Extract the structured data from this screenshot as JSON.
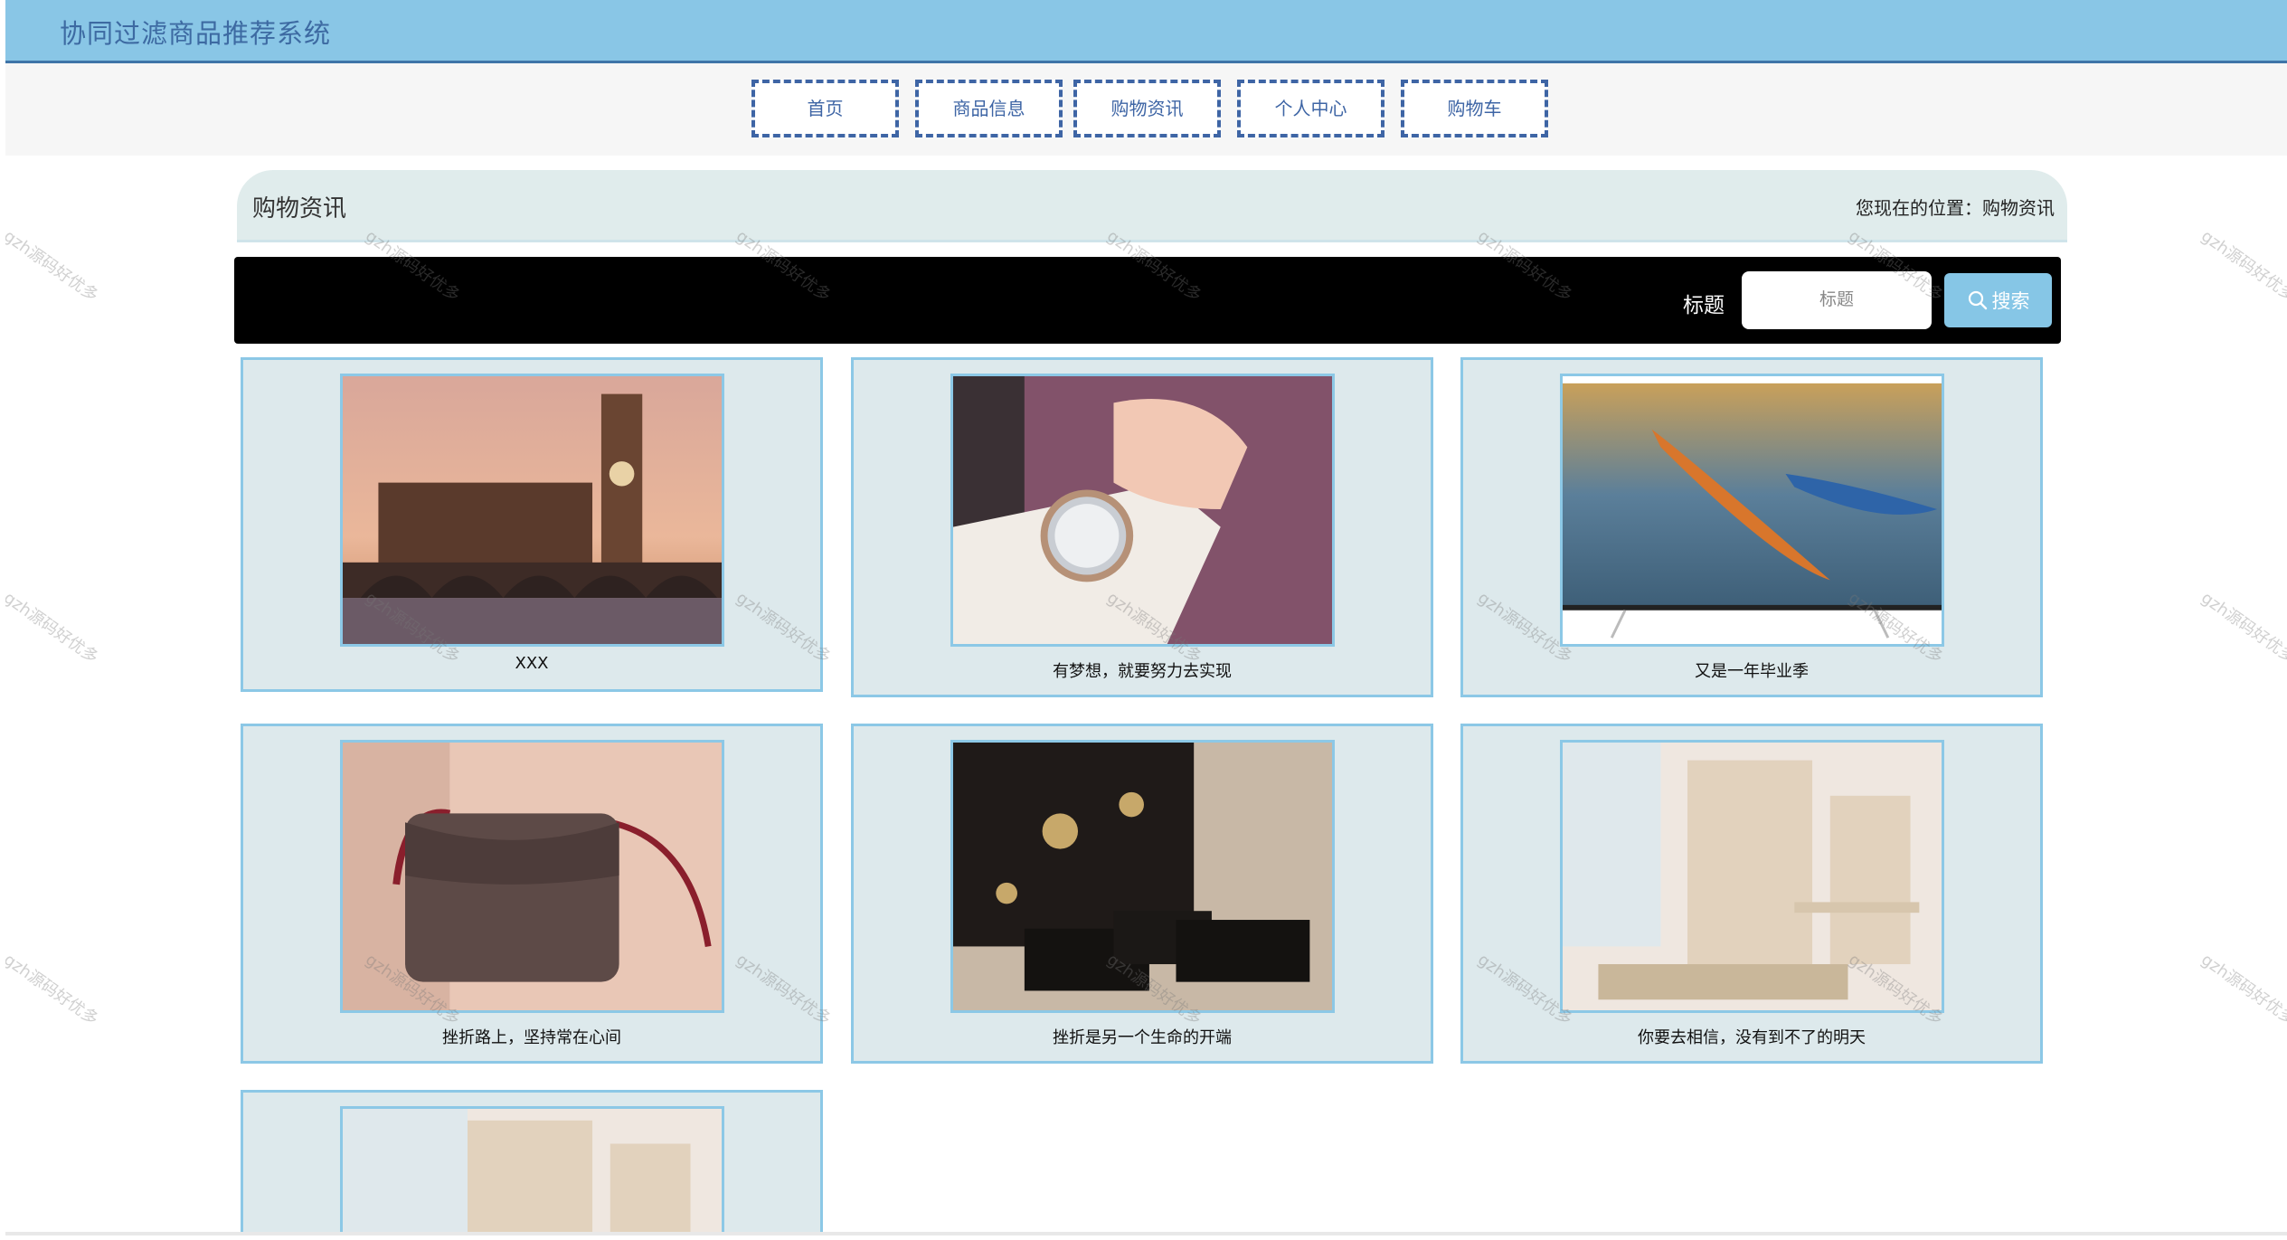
{
  "header": {
    "title": "协同过滤商品推荐系统"
  },
  "nav": {
    "items": [
      "首页",
      "商品信息",
      "购物资讯",
      "个人中心",
      "购物车"
    ]
  },
  "breadcrumb": {
    "section": "购物资讯",
    "location": "您现在的位置：购物资讯"
  },
  "search": {
    "label": "标题",
    "placeholder": "标题",
    "button_label": "搜索"
  },
  "news": [
    {
      "caption": "XXX",
      "image": "london-bridge-photo"
    },
    {
      "caption": "有梦想，就要努力去实现",
      "image": "wristwatch-photo"
    },
    {
      "caption": "又是一年毕业季",
      "image": "kayaks-tv-photo"
    },
    {
      "caption": "挫折路上，坚持常在心间",
      "image": "handbag-photo"
    },
    {
      "caption": "挫折是另一个生命的开端",
      "image": "lacquer-boxes-photo"
    },
    {
      "caption": "你要去相信，没有到不了的明天",
      "image": "bookshelf-desk-photo"
    },
    {
      "caption": "",
      "image": "bookshelf-desk-photo"
    }
  ],
  "watermark": "gzh源码好优多",
  "colors": {
    "header_bg": "#89c6e6",
    "nav_border": "#3e65a5",
    "card_bg": "#dde9ec",
    "card_border": "#8cc8e6",
    "search_button": "#86c6e6"
  }
}
